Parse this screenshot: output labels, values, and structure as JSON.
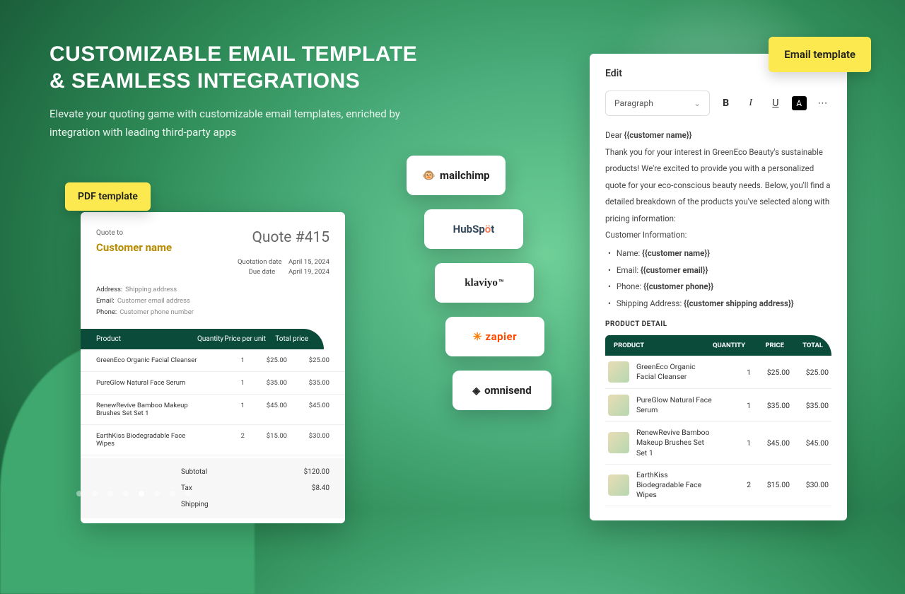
{
  "hero": {
    "title_l1": "CUSTOMIZABLE EMAIL TEMPLATE",
    "title_l2": "& SEAMLESS INTEGRATIONS",
    "subtitle": "Elevate your quoting game with customizable email templates, enriched by integration with leading third-party apps"
  },
  "tags": {
    "pdf": "PDF  template",
    "email": "Email template"
  },
  "integrations": [
    {
      "name": "mailchimp",
      "label": "mailchimp"
    },
    {
      "name": "hubspot",
      "label": "HubSpot"
    },
    {
      "name": "klaviyo",
      "label": "klaviyo"
    },
    {
      "name": "zapier",
      "label": "zapier"
    },
    {
      "name": "omnisend",
      "label": "omnisend"
    }
  ],
  "pdf": {
    "quote_to_label": "Quote to",
    "customer_name": "Customer name",
    "quote_no": "Quote #415",
    "quotation_date_label": "Quotation date",
    "quotation_date": "April 15, 2024",
    "due_date_label": "Due date",
    "due_date": "April 19, 2024",
    "address_k": "Address:",
    "address_v": "Shipping address",
    "email_k": "Email:",
    "email_v": "Customer email address",
    "phone_k": "Phone:",
    "phone_v": "Customer phone number",
    "th": {
      "product": "Product",
      "qty": "Quantity",
      "ppu": "Price per unit",
      "total": "Total price"
    },
    "rows": [
      {
        "name": "GreenEco Organic Facial Cleanser",
        "qty": "1",
        "ppu": "$25.00",
        "total": "$25.00"
      },
      {
        "name": "PureGlow Natural Face Serum",
        "qty": "1",
        "ppu": "$35.00",
        "total": "$35.00"
      },
      {
        "name": "RenewRevive Bamboo Makeup Brushes Set Set 1",
        "qty": "1",
        "ppu": "$45.00",
        "total": "$45.00"
      },
      {
        "name": "EarthKiss Biodegradable Face Wipes",
        "qty": "2",
        "ppu": "$15.00",
        "total": "$30.00"
      }
    ],
    "summary": {
      "subtotal_k": "Subtotal",
      "subtotal_v": "$120.00",
      "tax_k": "Tax",
      "tax_v": "$8.40",
      "shipping_k": "Shipping"
    }
  },
  "email": {
    "edit_label": "Edit",
    "paragraph": "Paragraph",
    "dear": "Dear ",
    "dear_var": "{{customer name}}",
    "para": "Thank you for your interest in GreenEco Beauty's sustainable products! We're excited to provide you with a personalized quote for your eco-conscious beauty needs. Below, you'll find a detailed breakdown of the products you've selected along with pricing information:",
    "cust_info": "Customer Information:",
    "li_name_k": "Name: ",
    "li_name_v": "{{customer name}}",
    "li_email_k": "Email: ",
    "li_email_v": "{{customer email}}",
    "li_phone_k": "Phone: ",
    "li_phone_v": "{{customer phone}}",
    "li_ship_k": "Shipping Address: ",
    "li_ship_v": "{{customer shipping address}}",
    "section": "PRODUCT DETAIL",
    "th": {
      "product": "PRODUCT",
      "qty": "QUANTITY",
      "price": "PRICE",
      "total": "TOTAL"
    },
    "rows": [
      {
        "name": "GreenEco Organic Facial Cleanser",
        "qty": "1",
        "price": "$25.00",
        "total": "$25.00"
      },
      {
        "name": "PureGlow Natural Face Serum",
        "qty": "1",
        "price": "$35.00",
        "total": "$35.00"
      },
      {
        "name": "RenewRevive Bamboo Makeup Brushes Set Set 1",
        "qty": "1",
        "price": "$45.00",
        "total": "$45.00"
      },
      {
        "name": "EarthKiss Biodegradable Face Wipes",
        "qty": "2",
        "price": "$15.00",
        "total": "$30.00"
      }
    ]
  },
  "pagination": {
    "count": 8,
    "active": 5
  }
}
